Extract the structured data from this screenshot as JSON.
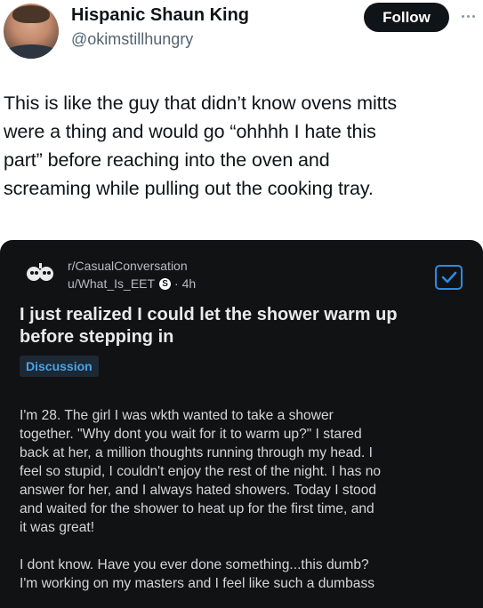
{
  "tweet": {
    "display_name": "Hispanic Shaun King",
    "handle": "@okimstillhungry",
    "follow_label": "Follow",
    "more_icon": "more-horizontal-icon",
    "text_lines": [
      "This is like the guy that didn’t know ovens mitts",
      "were a thing and would go “ohhhh I hate this",
      "part” before reaching into the oven and",
      "screaming while pulling out the cooking tray."
    ]
  },
  "reddit_card": {
    "subreddit": "r/CasualConversation",
    "user": "u/What_Is_EET",
    "badge": "S",
    "age": "· 4h",
    "title_lines": [
      "I just realized I could let the shower warm up",
      "before stepping in"
    ],
    "flair": "Discussion",
    "paragraph_1_lines": [
      "I'm 28. The girl I was wkth wanted to take a shower",
      "together. \"Why dont you wait for it to warm up?\" I stared",
      "back at her, a million thoughts running through my head. I",
      "feel so stupid, I couldn't enjoy the rest of the night. I has no",
      "answer for her, and I always hated showers. Today I stood",
      "and waited for the shower to heat up for the first time, and",
      "it was great!"
    ],
    "paragraph_2_lines": [
      "I dont know. Have you ever done something...this dumb?",
      "I'm working on my masters and I feel like such a dumbass"
    ],
    "colors": {
      "card_bg": "#111214",
      "flair_text": "#4aa3e8",
      "checkbox": "#2b8be6"
    }
  }
}
